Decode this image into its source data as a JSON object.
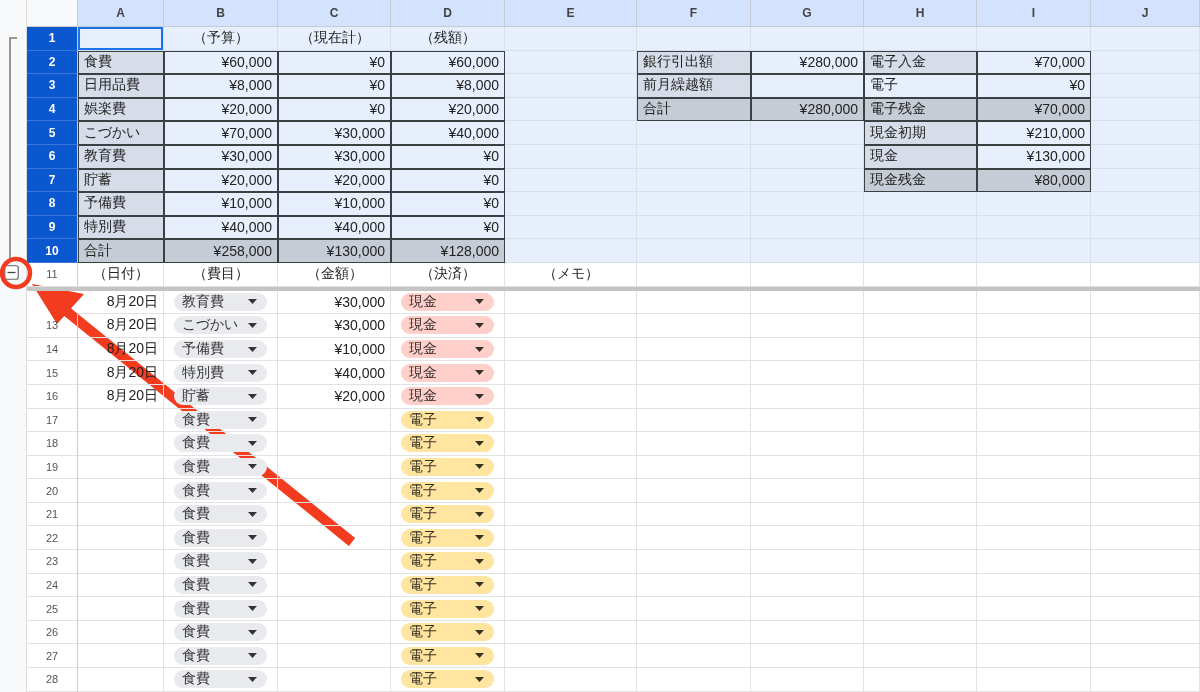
{
  "columns": [
    {
      "label": "A",
      "selected": true
    },
    {
      "label": "B",
      "selected": true
    },
    {
      "label": "C",
      "selected": true
    },
    {
      "label": "D",
      "selected": true
    },
    {
      "label": "E",
      "selected": true
    },
    {
      "label": "F",
      "selected": true
    },
    {
      "label": "G",
      "selected": true
    },
    {
      "label": "H",
      "selected": true
    },
    {
      "label": "I",
      "selected": true
    },
    {
      "label": "J",
      "selected": true
    }
  ],
  "group_toggle": {
    "expanded": true
  },
  "frozen_rows": [
    {
      "number": "1",
      "selected": true,
      "cells": [
        {
          "kind": "empty",
          "active": true
        },
        {
          "kind": "heading",
          "text": "（予算）"
        },
        {
          "kind": "heading",
          "text": "（現在計）"
        },
        {
          "kind": "heading",
          "text": "（残額）"
        },
        {
          "kind": "empty"
        },
        {
          "kind": "empty"
        },
        {
          "kind": "empty"
        },
        {
          "kind": "empty"
        },
        {
          "kind": "empty"
        },
        {
          "kind": "empty"
        }
      ]
    },
    {
      "number": "2",
      "selected": true,
      "cells": [
        {
          "kind": "label",
          "text": "食費"
        },
        {
          "kind": "value",
          "text": "¥60,000"
        },
        {
          "kind": "value",
          "text": "¥0"
        },
        {
          "kind": "value",
          "text": "¥60,000"
        },
        {
          "kind": "empty"
        },
        {
          "kind": "label",
          "text": "銀行引出額"
        },
        {
          "kind": "value",
          "text": "¥280,000"
        },
        {
          "kind": "label",
          "text": "電子入金"
        },
        {
          "kind": "value",
          "text": "¥70,000"
        },
        {
          "kind": "empty"
        }
      ]
    },
    {
      "number": "3",
      "selected": true,
      "cells": [
        {
          "kind": "label",
          "text": "日用品費"
        },
        {
          "kind": "value",
          "text": "¥8,000"
        },
        {
          "kind": "value",
          "text": "¥0"
        },
        {
          "kind": "value",
          "text": "¥8,000"
        },
        {
          "kind": "empty"
        },
        {
          "kind": "label",
          "text": "前月繰越額"
        },
        {
          "kind": "value"
        },
        {
          "kind": "plain_label",
          "text": "電子"
        },
        {
          "kind": "value",
          "text": "¥0"
        },
        {
          "kind": "empty"
        }
      ]
    },
    {
      "number": "4",
      "selected": true,
      "cells": [
        {
          "kind": "label",
          "text": "娯楽費"
        },
        {
          "kind": "value",
          "text": "¥20,000"
        },
        {
          "kind": "value",
          "text": "¥0"
        },
        {
          "kind": "value",
          "text": "¥20,000"
        },
        {
          "kind": "empty"
        },
        {
          "kind": "total_label",
          "text": "合計"
        },
        {
          "kind": "total_value",
          "text": "¥280,000"
        },
        {
          "kind": "total_label",
          "text": "電子残金"
        },
        {
          "kind": "total_value",
          "text": "¥70,000"
        },
        {
          "kind": "empty"
        }
      ]
    },
    {
      "number": "5",
      "selected": true,
      "cells": [
        {
          "kind": "label",
          "text": "こづかい"
        },
        {
          "kind": "value",
          "text": "¥70,000"
        },
        {
          "kind": "value",
          "text": "¥30,000"
        },
        {
          "kind": "value",
          "text": "¥40,000"
        },
        {
          "kind": "empty"
        },
        {
          "kind": "empty"
        },
        {
          "kind": "empty"
        },
        {
          "kind": "label",
          "text": "現金初期"
        },
        {
          "kind": "value",
          "text": "¥210,000"
        },
        {
          "kind": "empty"
        }
      ]
    },
    {
      "number": "6",
      "selected": true,
      "cells": [
        {
          "kind": "label",
          "text": "教育費"
        },
        {
          "kind": "value",
          "text": "¥30,000"
        },
        {
          "kind": "value",
          "text": "¥30,000"
        },
        {
          "kind": "value",
          "text": "¥0"
        },
        {
          "kind": "empty"
        },
        {
          "kind": "empty"
        },
        {
          "kind": "empty"
        },
        {
          "kind": "label",
          "text": "現金"
        },
        {
          "kind": "value",
          "text": "¥130,000"
        },
        {
          "kind": "empty"
        }
      ]
    },
    {
      "number": "7",
      "selected": true,
      "cells": [
        {
          "kind": "label",
          "text": "貯蓄"
        },
        {
          "kind": "value",
          "text": "¥20,000"
        },
        {
          "kind": "value",
          "text": "¥20,000"
        },
        {
          "kind": "value",
          "text": "¥0"
        },
        {
          "kind": "empty"
        },
        {
          "kind": "empty"
        },
        {
          "kind": "empty"
        },
        {
          "kind": "total_label",
          "text": "現金残金"
        },
        {
          "kind": "total_value",
          "text": "¥80,000"
        },
        {
          "kind": "empty"
        }
      ]
    },
    {
      "number": "8",
      "selected": true,
      "cells": [
        {
          "kind": "label",
          "text": "予備費"
        },
        {
          "kind": "value",
          "text": "¥10,000"
        },
        {
          "kind": "value",
          "text": "¥10,000"
        },
        {
          "kind": "value",
          "text": "¥0"
        },
        {
          "kind": "empty"
        },
        {
          "kind": "empty"
        },
        {
          "kind": "empty"
        },
        {
          "kind": "empty"
        },
        {
          "kind": "empty"
        },
        {
          "kind": "empty"
        }
      ]
    },
    {
      "number": "9",
      "selected": true,
      "cells": [
        {
          "kind": "label",
          "text": "特別費"
        },
        {
          "kind": "value",
          "text": "¥40,000"
        },
        {
          "kind": "value",
          "text": "¥40,000"
        },
        {
          "kind": "value",
          "text": "¥0"
        },
        {
          "kind": "empty"
        },
        {
          "kind": "empty"
        },
        {
          "kind": "empty"
        },
        {
          "kind": "empty"
        },
        {
          "kind": "empty"
        },
        {
          "kind": "empty"
        }
      ]
    },
    {
      "number": "10",
      "selected": true,
      "cells": [
        {
          "kind": "total_label",
          "text": "合計"
        },
        {
          "kind": "total_value",
          "text": "¥258,000"
        },
        {
          "kind": "total_value",
          "text": "¥130,000"
        },
        {
          "kind": "total_value",
          "text": "¥128,000"
        },
        {
          "kind": "empty"
        },
        {
          "kind": "empty"
        },
        {
          "kind": "empty"
        },
        {
          "kind": "empty"
        },
        {
          "kind": "empty"
        },
        {
          "kind": "empty"
        }
      ]
    },
    {
      "number": "11",
      "selected": false,
      "cells": [
        {
          "kind": "heading",
          "text": "（日付）"
        },
        {
          "kind": "heading",
          "text": "（費目）"
        },
        {
          "kind": "heading",
          "text": "（金額）"
        },
        {
          "kind": "heading",
          "text": "（決済）"
        },
        {
          "kind": "heading",
          "text": "（メモ）"
        },
        {
          "kind": "empty"
        },
        {
          "kind": "empty"
        },
        {
          "kind": "empty"
        },
        {
          "kind": "empty"
        },
        {
          "kind": "empty"
        }
      ]
    }
  ],
  "rows": [
    {
      "cells": [
        {
          "kind": "date",
          "text": "8月20日"
        },
        {
          "kind": "chip",
          "text": "教育費",
          "color": "#e8eaed"
        },
        {
          "kind": "amount",
          "text": "¥30,000"
        },
        {
          "kind": "chip",
          "text": "現金",
          "color": "#ffcfc9"
        },
        {
          "kind": "empty"
        },
        {
          "kind": "empty"
        },
        {
          "kind": "empty"
        },
        {
          "kind": "empty"
        },
        {
          "kind": "empty"
        },
        {
          "kind": "empty"
        }
      ]
    },
    {
      "number": "13",
      "selected": false,
      "cells": [
        {
          "kind": "date",
          "text": "8月20日"
        },
        {
          "kind": "chip",
          "text": "こづかい",
          "color": "#e8eaed"
        },
        {
          "kind": "amount",
          "text": "¥30,000"
        },
        {
          "kind": "chip",
          "text": "現金",
          "color": "#ffcfc9"
        },
        {
          "kind": "empty"
        },
        {
          "kind": "empty"
        },
        {
          "kind": "empty"
        },
        {
          "kind": "empty"
        },
        {
          "kind": "empty"
        },
        {
          "kind": "empty"
        }
      ]
    },
    {
      "number": "14",
      "selected": false,
      "cells": [
        {
          "kind": "date",
          "text": "8月20日"
        },
        {
          "kind": "chip",
          "text": "予備費",
          "color": "#e8eaed"
        },
        {
          "kind": "amount",
          "text": "¥10,000"
        },
        {
          "kind": "chip",
          "text": "現金",
          "color": "#ffcfc9"
        },
        {
          "kind": "empty"
        },
        {
          "kind": "empty"
        },
        {
          "kind": "empty"
        },
        {
          "kind": "empty"
        },
        {
          "kind": "empty"
        },
        {
          "kind": "empty"
        }
      ]
    },
    {
      "number": "15",
      "selected": false,
      "cells": [
        {
          "kind": "date",
          "text": "8月20日"
        },
        {
          "kind": "chip",
          "text": "特別費",
          "color": "#e8eaed"
        },
        {
          "kind": "amount",
          "text": "¥40,000"
        },
        {
          "kind": "chip",
          "text": "現金",
          "color": "#ffcfc9"
        },
        {
          "kind": "empty"
        },
        {
          "kind": "empty"
        },
        {
          "kind": "empty"
        },
        {
          "kind": "empty"
        },
        {
          "kind": "empty"
        },
        {
          "kind": "empty"
        }
      ]
    },
    {
      "number": "16",
      "selected": false,
      "cells": [
        {
          "kind": "date",
          "text": "8月20日"
        },
        {
          "kind": "chip",
          "text": "貯蓄",
          "color": "#e8eaed"
        },
        {
          "kind": "amount",
          "text": "¥20,000"
        },
        {
          "kind": "chip",
          "text": "現金",
          "color": "#ffcfc9"
        },
        {
          "kind": "empty"
        },
        {
          "kind": "empty"
        },
        {
          "kind": "empty"
        },
        {
          "kind": "empty"
        },
        {
          "kind": "empty"
        },
        {
          "kind": "empty"
        }
      ]
    },
    {
      "number": "17",
      "selected": false,
      "cells": [
        {
          "kind": "empty"
        },
        {
          "kind": "chip",
          "text": "食費",
          "color": "#e8eaed"
        },
        {
          "kind": "empty"
        },
        {
          "kind": "chip",
          "text": "電子",
          "color": "#ffe5a0"
        },
        {
          "kind": "empty"
        },
        {
          "kind": "empty"
        },
        {
          "kind": "empty"
        },
        {
          "kind": "empty"
        },
        {
          "kind": "empty"
        },
        {
          "kind": "empty"
        }
      ]
    },
    {
      "number": "18",
      "selected": false,
      "cells": [
        {
          "kind": "empty"
        },
        {
          "kind": "chip",
          "text": "食費",
          "color": "#e8eaed"
        },
        {
          "kind": "empty"
        },
        {
          "kind": "chip",
          "text": "電子",
          "color": "#ffe5a0"
        },
        {
          "kind": "empty"
        },
        {
          "kind": "empty"
        },
        {
          "kind": "empty"
        },
        {
          "kind": "empty"
        },
        {
          "kind": "empty"
        },
        {
          "kind": "empty"
        }
      ]
    },
    {
      "number": "19",
      "selected": false,
      "cells": [
        {
          "kind": "empty"
        },
        {
          "kind": "chip",
          "text": "食費",
          "color": "#e8eaed"
        },
        {
          "kind": "empty"
        },
        {
          "kind": "chip",
          "text": "電子",
          "color": "#ffe5a0"
        },
        {
          "kind": "empty"
        },
        {
          "kind": "empty"
        },
        {
          "kind": "empty"
        },
        {
          "kind": "empty"
        },
        {
          "kind": "empty"
        },
        {
          "kind": "empty"
        }
      ]
    },
    {
      "number": "20",
      "selected": false,
      "cells": [
        {
          "kind": "empty"
        },
        {
          "kind": "chip",
          "text": "食費",
          "color": "#e8eaed"
        },
        {
          "kind": "empty"
        },
        {
          "kind": "chip",
          "text": "電子",
          "color": "#ffe5a0"
        },
        {
          "kind": "empty"
        },
        {
          "kind": "empty"
        },
        {
          "kind": "empty"
        },
        {
          "kind": "empty"
        },
        {
          "kind": "empty"
        },
        {
          "kind": "empty"
        }
      ]
    },
    {
      "number": "21",
      "selected": false,
      "cells": [
        {
          "kind": "empty"
        },
        {
          "kind": "chip",
          "text": "食費",
          "color": "#e8eaed"
        },
        {
          "kind": "empty"
        },
        {
          "kind": "chip",
          "text": "電子",
          "color": "#ffe5a0"
        },
        {
          "kind": "empty"
        },
        {
          "kind": "empty"
        },
        {
          "kind": "empty"
        },
        {
          "kind": "empty"
        },
        {
          "kind": "empty"
        },
        {
          "kind": "empty"
        }
      ]
    },
    {
      "number": "22",
      "selected": false,
      "cells": [
        {
          "kind": "empty"
        },
        {
          "kind": "chip",
          "text": "食費",
          "color": "#e8eaed"
        },
        {
          "kind": "empty"
        },
        {
          "kind": "chip",
          "text": "電子",
          "color": "#ffe5a0"
        },
        {
          "kind": "empty"
        },
        {
          "kind": "empty"
        },
        {
          "kind": "empty"
        },
        {
          "kind": "empty"
        },
        {
          "kind": "empty"
        },
        {
          "kind": "empty"
        }
      ]
    },
    {
      "number": "23",
      "selected": false,
      "cells": [
        {
          "kind": "empty"
        },
        {
          "kind": "chip",
          "text": "食費",
          "color": "#e8eaed"
        },
        {
          "kind": "empty"
        },
        {
          "kind": "chip",
          "text": "電子",
          "color": "#ffe5a0"
        },
        {
          "kind": "empty"
        },
        {
          "kind": "empty"
        },
        {
          "kind": "empty"
        },
        {
          "kind": "empty"
        },
        {
          "kind": "empty"
        },
        {
          "kind": "empty"
        }
      ]
    },
    {
      "number": "24",
      "selected": false,
      "cells": [
        {
          "kind": "empty"
        },
        {
          "kind": "chip",
          "text": "食費",
          "color": "#e8eaed"
        },
        {
          "kind": "empty"
        },
        {
          "kind": "chip",
          "text": "電子",
          "color": "#ffe5a0"
        },
        {
          "kind": "empty"
        },
        {
          "kind": "empty"
        },
        {
          "kind": "empty"
        },
        {
          "kind": "empty"
        },
        {
          "kind": "empty"
        },
        {
          "kind": "empty"
        }
      ]
    },
    {
      "number": "25",
      "selected": false,
      "cells": [
        {
          "kind": "empty"
        },
        {
          "kind": "chip",
          "text": "食費",
          "color": "#e8eaed"
        },
        {
          "kind": "empty"
        },
        {
          "kind": "chip",
          "text": "電子",
          "color": "#ffe5a0"
        },
        {
          "kind": "empty"
        },
        {
          "kind": "empty"
        },
        {
          "kind": "empty"
        },
        {
          "kind": "empty"
        },
        {
          "kind": "empty"
        },
        {
          "kind": "empty"
        }
      ]
    },
    {
      "number": "26",
      "selected": false,
      "cells": [
        {
          "kind": "empty"
        },
        {
          "kind": "chip",
          "text": "食費",
          "color": "#e8eaed"
        },
        {
          "kind": "empty"
        },
        {
          "kind": "chip",
          "text": "電子",
          "color": "#ffe5a0"
        },
        {
          "kind": "empty"
        },
        {
          "kind": "empty"
        },
        {
          "kind": "empty"
        },
        {
          "kind": "empty"
        },
        {
          "kind": "empty"
        },
        {
          "kind": "empty"
        }
      ]
    },
    {
      "number": "27",
      "selected": false,
      "cells": [
        {
          "kind": "empty"
        },
        {
          "kind": "chip",
          "text": "食費",
          "color": "#e8eaed"
        },
        {
          "kind": "empty"
        },
        {
          "kind": "chip",
          "text": "電子",
          "color": "#ffe5a0"
        },
        {
          "kind": "empty"
        },
        {
          "kind": "empty"
        },
        {
          "kind": "empty"
        },
        {
          "kind": "empty"
        },
        {
          "kind": "empty"
        },
        {
          "kind": "empty"
        }
      ]
    },
    {
      "number": "28",
      "selected": false,
      "cells": [
        {
          "kind": "empty"
        },
        {
          "kind": "chip",
          "text": "食費",
          "color": "#e8eaed"
        },
        {
          "kind": "empty"
        },
        {
          "kind": "chip",
          "text": "電子",
          "color": "#ffe5a0"
        },
        {
          "kind": "empty"
        },
        {
          "kind": "empty"
        },
        {
          "kind": "empty"
        },
        {
          "kind": "empty"
        },
        {
          "kind": "empty"
        },
        {
          "kind": "empty"
        }
      ]
    }
  ]
}
